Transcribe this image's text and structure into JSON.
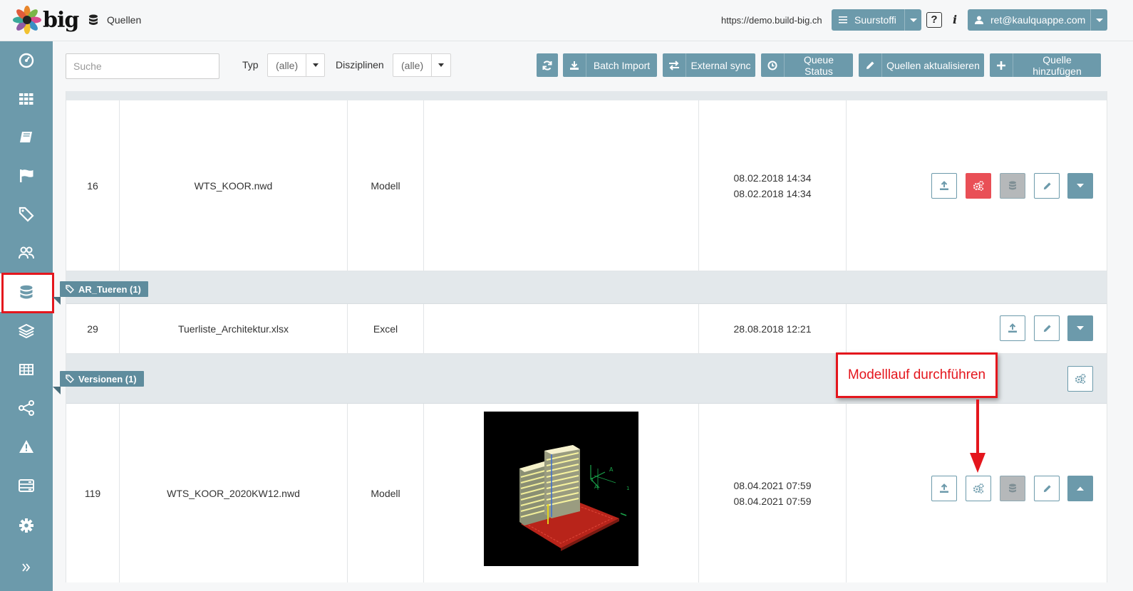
{
  "header": {
    "logo_text": "big",
    "breadcrumb": "Quellen",
    "url": "https://demo.build-big.ch",
    "project": "Suurstoffi",
    "help": "?",
    "info": "i",
    "user": "ret@kaulquappe.com"
  },
  "sidebar": {
    "items": [
      {
        "icon": "dashboard-icon"
      },
      {
        "icon": "grid-icon"
      },
      {
        "icon": "book-icon"
      },
      {
        "icon": "flag-icon"
      },
      {
        "icon": "tags-icon"
      },
      {
        "icon": "users-icon"
      },
      {
        "icon": "database-icon",
        "active": true
      },
      {
        "icon": "layers-icon"
      },
      {
        "icon": "table-icon"
      },
      {
        "icon": "share-icon"
      },
      {
        "icon": "warning-icon"
      },
      {
        "icon": "server-icon"
      },
      {
        "icon": "gear-icon"
      },
      {
        "icon": "expand-icon"
      }
    ]
  },
  "filters": {
    "search_placeholder": "Suche",
    "type_label": "Typ",
    "type_value": "(alle)",
    "disciplines_label": "Disziplinen",
    "disciplines_value": "(alle)"
  },
  "toolbar": {
    "batch_import": "Batch Import",
    "external_sync": "External sync",
    "queue_status": "Queue Status",
    "update_sources": "Quellen aktualisieren",
    "add_source": "Quelle hinzufügen"
  },
  "groups": {
    "ar_tueren": "AR_Tueren (1)",
    "versionen": "Versionen (1)"
  },
  "rows": [
    {
      "id": "16",
      "name": "WTS_KOOR.nwd",
      "type": "Modell",
      "date1": "08.02.2018 14:34",
      "date2": "08.02.2018 14:34"
    },
    {
      "id": "29",
      "name": "Tuerliste_Architektur.xlsx",
      "type": "Excel",
      "date1": "28.08.2018 12:21",
      "date2": ""
    },
    {
      "id": "119",
      "name": "WTS_KOOR_2020KW12.nwd",
      "type": "Modell",
      "date1": "08.04.2021 07:59",
      "date2": "08.04.2021 07:59"
    }
  ],
  "annotation": {
    "callout": "Modelllauf durchführen",
    "color": "#e4161d"
  },
  "colors": {
    "primary": "#6c9aab",
    "danger": "#e94f56",
    "group_bg": "#e3e8eb"
  }
}
